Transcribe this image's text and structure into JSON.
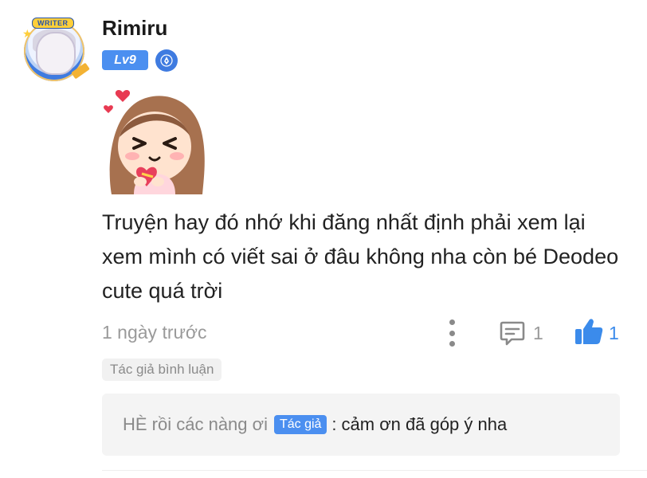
{
  "comment": {
    "username": "Rimiru",
    "avatar_badge": "WRITER",
    "level": "Lv9",
    "text": "Truyện hay đó nhớ khi đăng nhất định phải xem lại xem mình có viết sai ở đâu không nha còn bé Deodeo cute quá trời",
    "timestamp": "1 ngày trước",
    "reply_count": "1",
    "like_count": "1",
    "author_tag": "Tác giả bình luận"
  },
  "reply": {
    "name": "HÈ rồi các nàng ơi",
    "author_badge": "Tác giả",
    "separator": ":",
    "text": "cảm ơn đã góp ý nha"
  },
  "icons": {
    "writer_badge": "pen-nib-icon",
    "more": "more-vertical-icon",
    "reply": "comment-bubble-icon",
    "like": "thumbs-up-icon"
  },
  "colors": {
    "accent": "#4b8ff0",
    "like_active": "#3b8beb",
    "muted_text": "#9a9a9a",
    "reply_bg": "#f4f4f4"
  }
}
